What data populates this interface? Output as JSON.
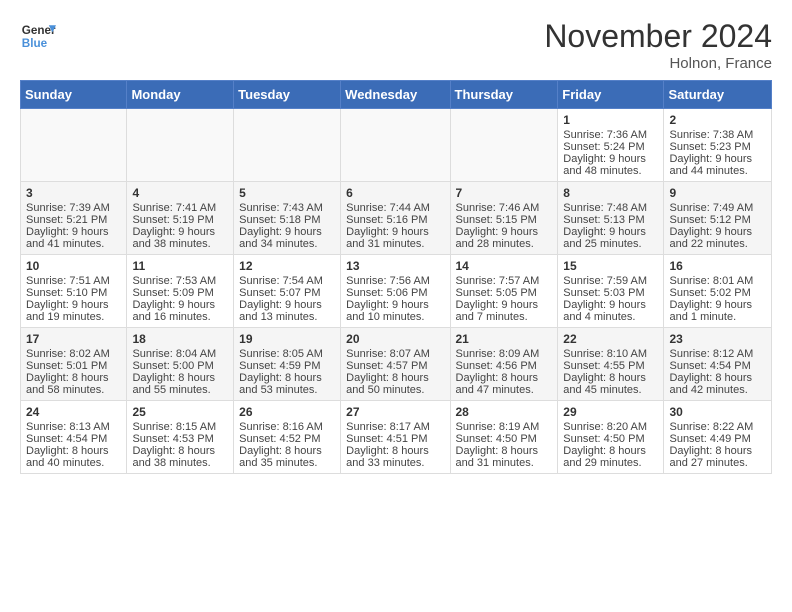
{
  "logo": {
    "line1": "General",
    "line2": "Blue"
  },
  "title": "November 2024",
  "location": "Holnon, France",
  "days_header": [
    "Sunday",
    "Monday",
    "Tuesday",
    "Wednesday",
    "Thursday",
    "Friday",
    "Saturday"
  ],
  "weeks": [
    [
      {
        "day": "",
        "info": ""
      },
      {
        "day": "",
        "info": ""
      },
      {
        "day": "",
        "info": ""
      },
      {
        "day": "",
        "info": ""
      },
      {
        "day": "",
        "info": ""
      },
      {
        "day": "1",
        "info": "Sunrise: 7:36 AM\nSunset: 5:24 PM\nDaylight: 9 hours and 48 minutes."
      },
      {
        "day": "2",
        "info": "Sunrise: 7:38 AM\nSunset: 5:23 PM\nDaylight: 9 hours and 44 minutes."
      }
    ],
    [
      {
        "day": "3",
        "info": "Sunrise: 7:39 AM\nSunset: 5:21 PM\nDaylight: 9 hours and 41 minutes."
      },
      {
        "day": "4",
        "info": "Sunrise: 7:41 AM\nSunset: 5:19 PM\nDaylight: 9 hours and 38 minutes."
      },
      {
        "day": "5",
        "info": "Sunrise: 7:43 AM\nSunset: 5:18 PM\nDaylight: 9 hours and 34 minutes."
      },
      {
        "day": "6",
        "info": "Sunrise: 7:44 AM\nSunset: 5:16 PM\nDaylight: 9 hours and 31 minutes."
      },
      {
        "day": "7",
        "info": "Sunrise: 7:46 AM\nSunset: 5:15 PM\nDaylight: 9 hours and 28 minutes."
      },
      {
        "day": "8",
        "info": "Sunrise: 7:48 AM\nSunset: 5:13 PM\nDaylight: 9 hours and 25 minutes."
      },
      {
        "day": "9",
        "info": "Sunrise: 7:49 AM\nSunset: 5:12 PM\nDaylight: 9 hours and 22 minutes."
      }
    ],
    [
      {
        "day": "10",
        "info": "Sunrise: 7:51 AM\nSunset: 5:10 PM\nDaylight: 9 hours and 19 minutes."
      },
      {
        "day": "11",
        "info": "Sunrise: 7:53 AM\nSunset: 5:09 PM\nDaylight: 9 hours and 16 minutes."
      },
      {
        "day": "12",
        "info": "Sunrise: 7:54 AM\nSunset: 5:07 PM\nDaylight: 9 hours and 13 minutes."
      },
      {
        "day": "13",
        "info": "Sunrise: 7:56 AM\nSunset: 5:06 PM\nDaylight: 9 hours and 10 minutes."
      },
      {
        "day": "14",
        "info": "Sunrise: 7:57 AM\nSunset: 5:05 PM\nDaylight: 9 hours and 7 minutes."
      },
      {
        "day": "15",
        "info": "Sunrise: 7:59 AM\nSunset: 5:03 PM\nDaylight: 9 hours and 4 minutes."
      },
      {
        "day": "16",
        "info": "Sunrise: 8:01 AM\nSunset: 5:02 PM\nDaylight: 9 hours and 1 minute."
      }
    ],
    [
      {
        "day": "17",
        "info": "Sunrise: 8:02 AM\nSunset: 5:01 PM\nDaylight: 8 hours and 58 minutes."
      },
      {
        "day": "18",
        "info": "Sunrise: 8:04 AM\nSunset: 5:00 PM\nDaylight: 8 hours and 55 minutes."
      },
      {
        "day": "19",
        "info": "Sunrise: 8:05 AM\nSunset: 4:59 PM\nDaylight: 8 hours and 53 minutes."
      },
      {
        "day": "20",
        "info": "Sunrise: 8:07 AM\nSunset: 4:57 PM\nDaylight: 8 hours and 50 minutes."
      },
      {
        "day": "21",
        "info": "Sunrise: 8:09 AM\nSunset: 4:56 PM\nDaylight: 8 hours and 47 minutes."
      },
      {
        "day": "22",
        "info": "Sunrise: 8:10 AM\nSunset: 4:55 PM\nDaylight: 8 hours and 45 minutes."
      },
      {
        "day": "23",
        "info": "Sunrise: 8:12 AM\nSunset: 4:54 PM\nDaylight: 8 hours and 42 minutes."
      }
    ],
    [
      {
        "day": "24",
        "info": "Sunrise: 8:13 AM\nSunset: 4:54 PM\nDaylight: 8 hours and 40 minutes."
      },
      {
        "day": "25",
        "info": "Sunrise: 8:15 AM\nSunset: 4:53 PM\nDaylight: 8 hours and 38 minutes."
      },
      {
        "day": "26",
        "info": "Sunrise: 8:16 AM\nSunset: 4:52 PM\nDaylight: 8 hours and 35 minutes."
      },
      {
        "day": "27",
        "info": "Sunrise: 8:17 AM\nSunset: 4:51 PM\nDaylight: 8 hours and 33 minutes."
      },
      {
        "day": "28",
        "info": "Sunrise: 8:19 AM\nSunset: 4:50 PM\nDaylight: 8 hours and 31 minutes."
      },
      {
        "day": "29",
        "info": "Sunrise: 8:20 AM\nSunset: 4:50 PM\nDaylight: 8 hours and 29 minutes."
      },
      {
        "day": "30",
        "info": "Sunrise: 8:22 AM\nSunset: 4:49 PM\nDaylight: 8 hours and 27 minutes."
      }
    ]
  ]
}
